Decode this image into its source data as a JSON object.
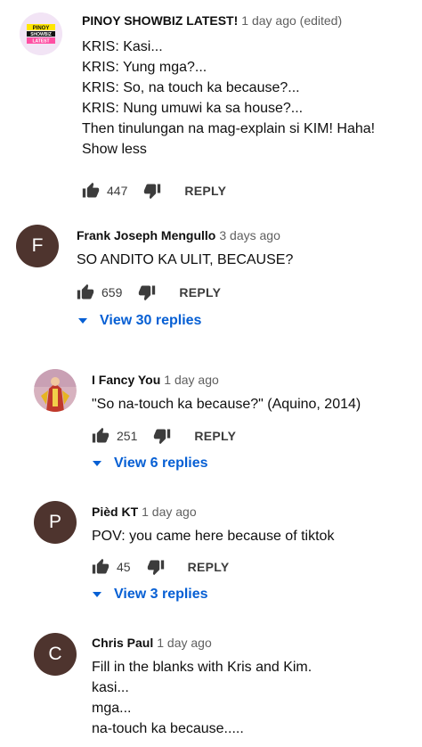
{
  "colors": {
    "link": "#065fd4",
    "avatar_dark": "#4e342e"
  },
  "comments": [
    {
      "avatar_text": [
        "PINOY",
        "SHOWBIZ",
        "LATEST"
      ],
      "author": "PINOY SHOWBIZ LATEST!",
      "time": "1 day ago (edited)",
      "lines": [
        "KRIS: Kasi...",
        "KRIS: Yung mga?...",
        "KRIS: So, na touch ka because?...",
        "KRIS: Nung umuwi ka sa house?...",
        "Then tinulungan na mag-explain si KIM! Haha!"
      ],
      "show_less": "Show less",
      "likes": "447",
      "reply": "REPLY"
    },
    {
      "avatar_letter": "F",
      "author": "Frank Joseph Mengullo",
      "time": "3 days ago",
      "lines": [
        "SO ANDITO KA ULIT, BECAUSE?"
      ],
      "likes": "659",
      "reply": "REPLY",
      "view_replies": "View 30 replies"
    },
    {
      "author": "I Fancy You",
      "time": "1 day ago",
      "lines": [
        "\"So na-touch ka because?\"  (Aquino, 2014)"
      ],
      "likes": "251",
      "reply": "REPLY",
      "view_replies": "View 6 replies"
    },
    {
      "avatar_letter": "P",
      "author": "Pièd KT",
      "time": "1 day ago",
      "lines": [
        "POV: you came here because of tiktok"
      ],
      "likes": "45",
      "reply": "REPLY",
      "view_replies": "View 3 replies"
    },
    {
      "avatar_letter": "C",
      "author": "Chris Paul",
      "time": "1 day ago",
      "lines": [
        "Fill in the blanks with Kris and Kim.",
        "kasi...",
        "mga...",
        "na-touch ka because....."
      ]
    }
  ]
}
